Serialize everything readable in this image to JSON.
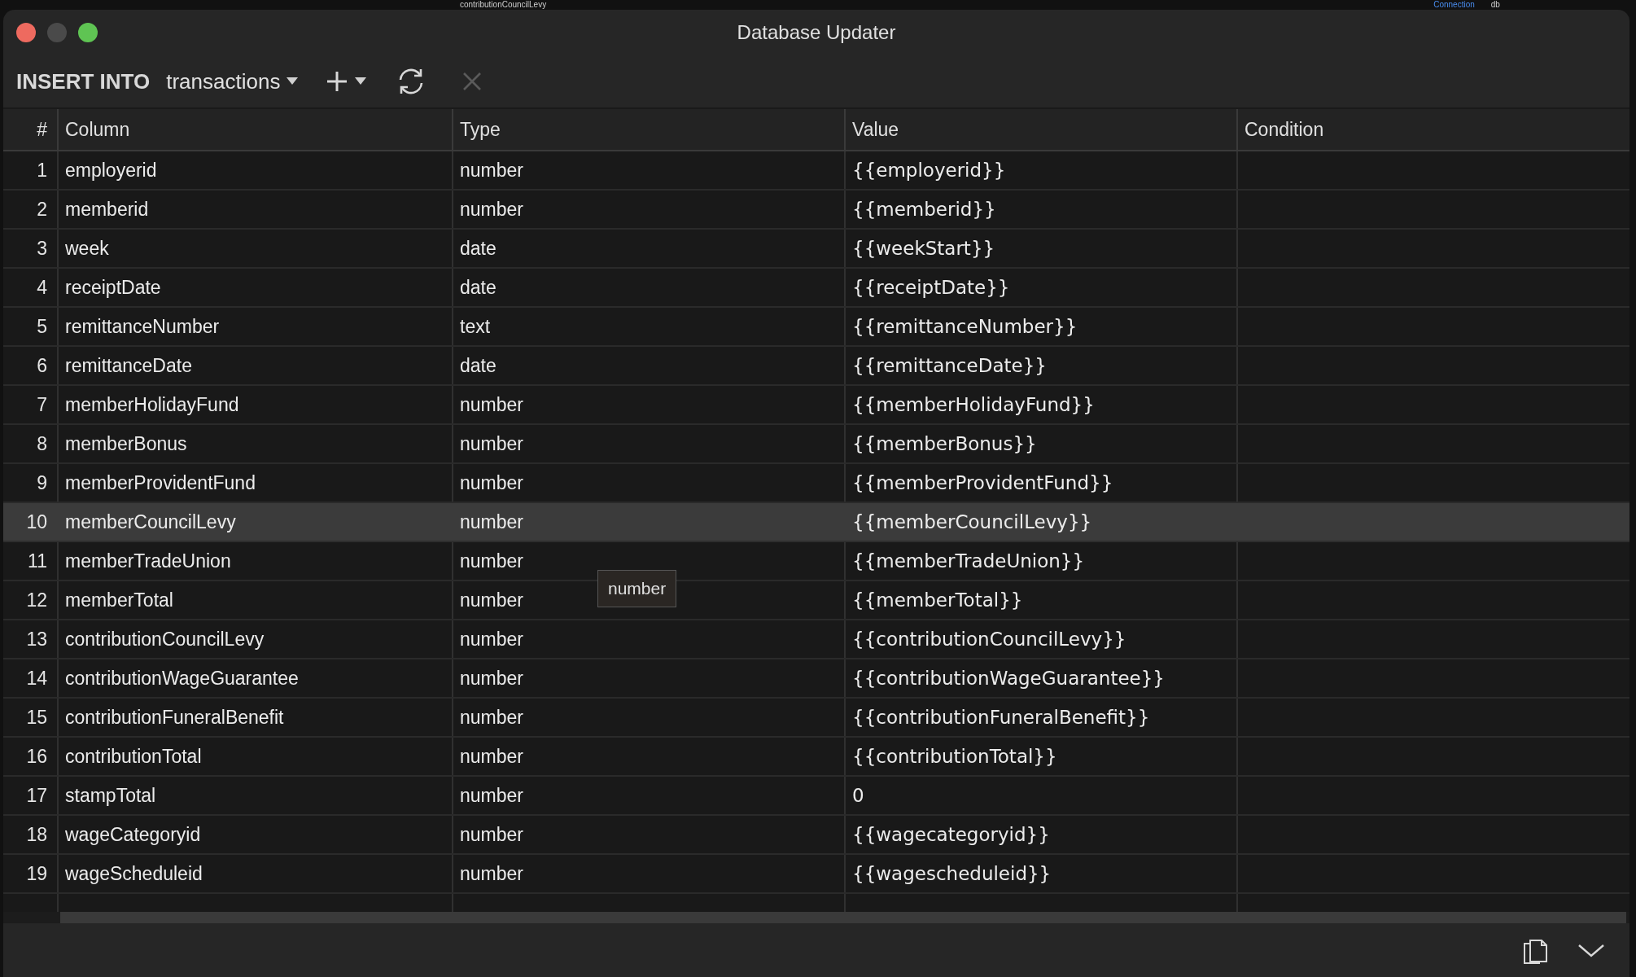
{
  "backdrop": {
    "texts": [
      "contributionCouncilLevy",
      "Connection",
      "db"
    ]
  },
  "window": {
    "title": "Database Updater"
  },
  "toolbar": {
    "statement": "INSERT INTO",
    "table": "transactions",
    "cancel_disabled": true
  },
  "table": {
    "columns": [
      "#",
      "Column",
      "Type",
      "Value",
      "Condition"
    ],
    "rows": [
      {
        "n": "1",
        "column": "employerid",
        "type": "number",
        "value": "{{employerid}}",
        "selected": false
      },
      {
        "n": "2",
        "column": "memberid",
        "type": "number",
        "value": "{{memberid}}",
        "selected": false
      },
      {
        "n": "3",
        "column": "week",
        "type": "date",
        "value": "{{weekStart}}",
        "selected": false
      },
      {
        "n": "4",
        "column": "receiptDate",
        "type": "date",
        "value": "{{receiptDate}}",
        "selected": false
      },
      {
        "n": "5",
        "column": "remittanceNumber",
        "type": "text",
        "value": "{{remittanceNumber}}",
        "selected": false
      },
      {
        "n": "6",
        "column": "remittanceDate",
        "type": "date",
        "value": "{{remittanceDate}}",
        "selected": false
      },
      {
        "n": "7",
        "column": "memberHolidayFund",
        "type": "number",
        "value": "{{memberHolidayFund}}",
        "selected": false
      },
      {
        "n": "8",
        "column": "memberBonus",
        "type": "number",
        "value": "{{memberBonus}}",
        "selected": false
      },
      {
        "n": "9",
        "column": "memberProvidentFund",
        "type": "number",
        "value": "{{memberProvidentFund}}",
        "selected": false
      },
      {
        "n": "10",
        "column": "memberCouncilLevy",
        "type": "number",
        "value": "{{memberCouncilLevy}}",
        "selected": true
      },
      {
        "n": "11",
        "column": "memberTradeUnion",
        "type": "number",
        "value": "{{memberTradeUnion}}",
        "selected": false
      },
      {
        "n": "12",
        "column": "memberTotal",
        "type": "number",
        "value": "{{memberTotal}}",
        "selected": false
      },
      {
        "n": "13",
        "column": "contributionCouncilLevy",
        "type": "number",
        "value": "{{contributionCouncilLevy}}",
        "selected": false
      },
      {
        "n": "14",
        "column": "contributionWageGuarantee",
        "type": "number",
        "value": "{{contributionWageGuarantee}}",
        "selected": false
      },
      {
        "n": "15",
        "column": "contributionFuneralBenefit",
        "type": "number",
        "value": "{{contributionFuneralBenefit}}",
        "selected": false
      },
      {
        "n": "16",
        "column": "contributionTotal",
        "type": "number",
        "value": "{{contributionTotal}}",
        "selected": false
      },
      {
        "n": "17",
        "column": "stampTotal",
        "type": "number",
        "value": "0",
        "selected": false
      },
      {
        "n": "18",
        "column": "wageCategoryid",
        "type": "number",
        "value": "{{wagecategoryid}}",
        "selected": false
      },
      {
        "n": "19",
        "column": "wageScheduleid",
        "type": "number",
        "value": "{{wagescheduleid}}",
        "selected": false
      }
    ]
  },
  "tooltip": {
    "text": "number"
  }
}
